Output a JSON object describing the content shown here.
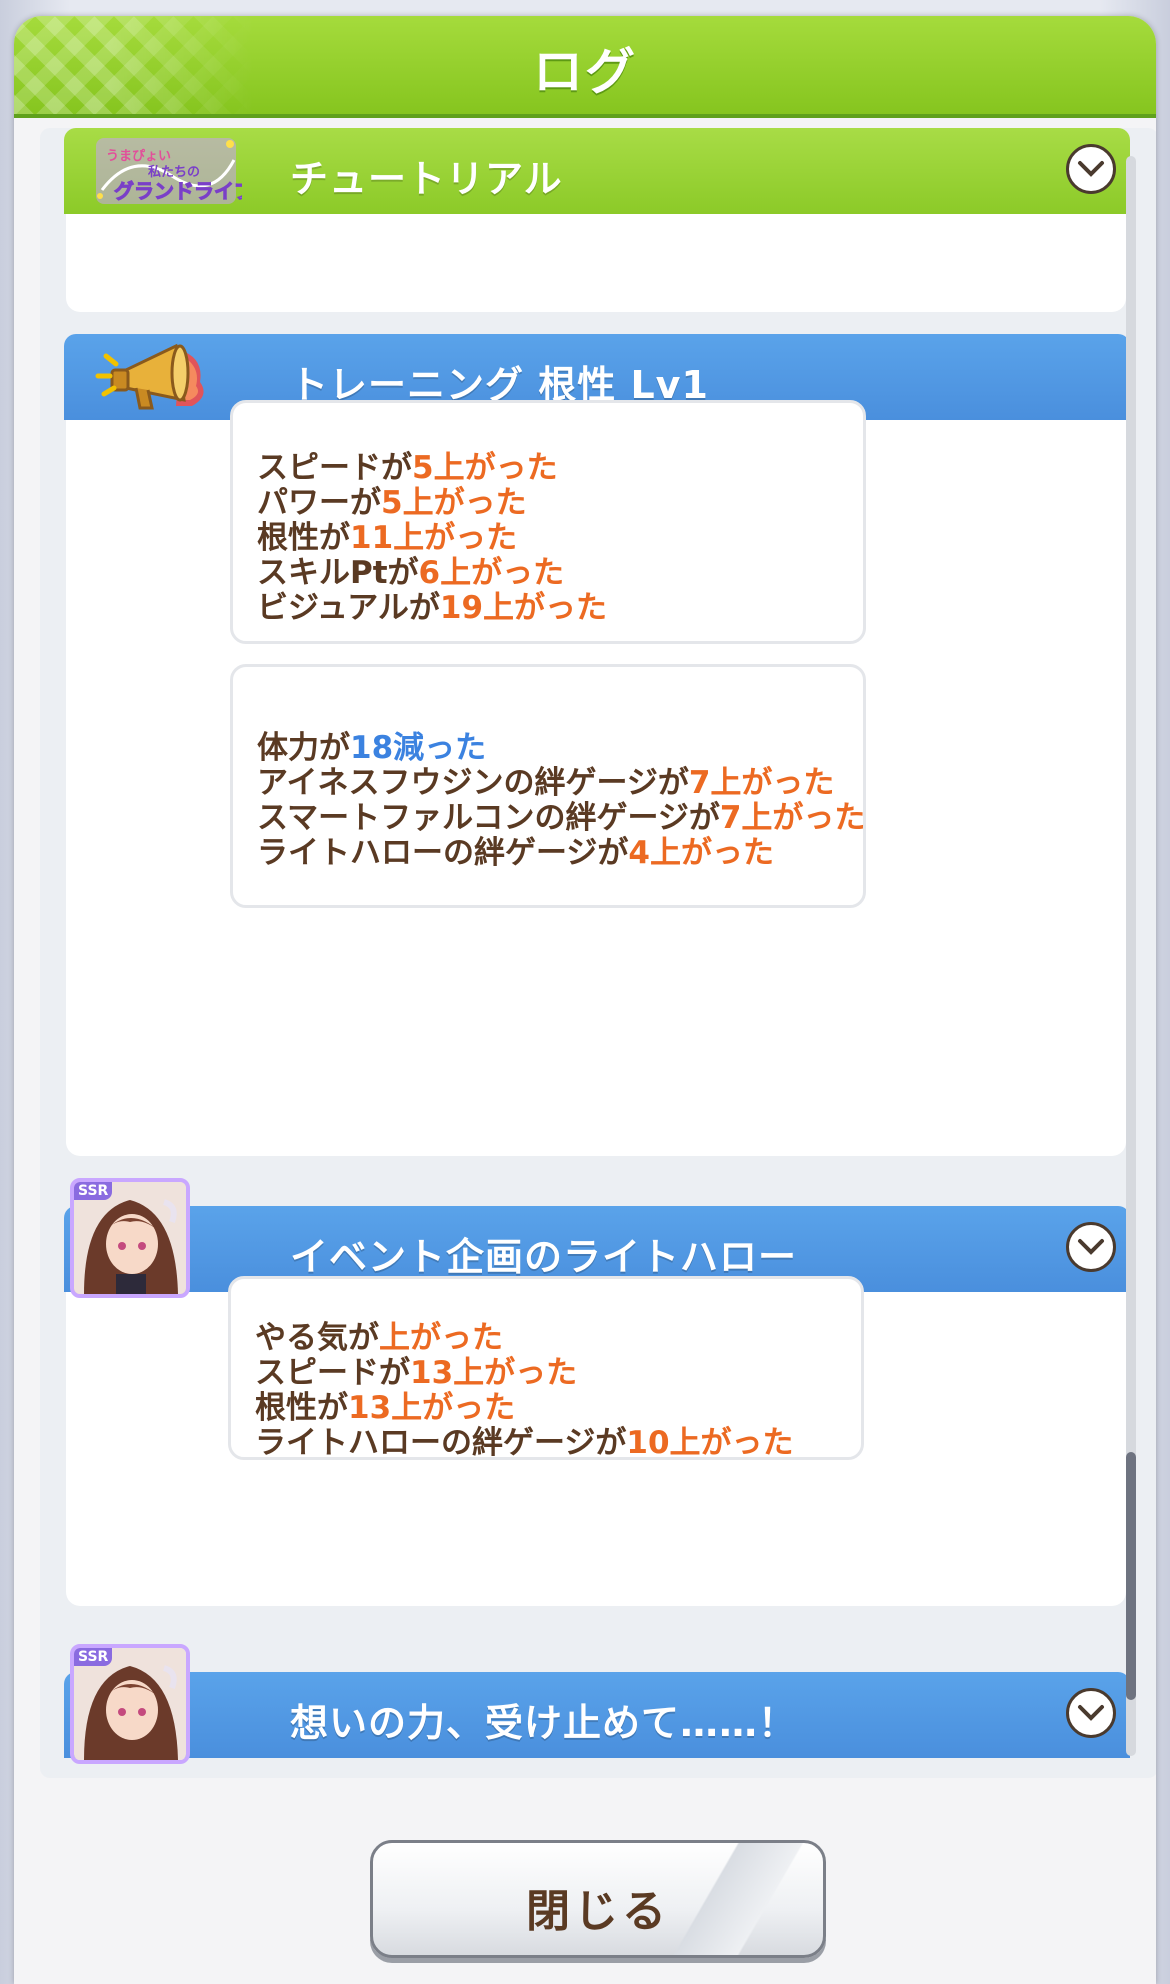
{
  "dialog": {
    "title": "ログ",
    "close_label": "閉じる"
  },
  "entries": [
    {
      "title": "チュートリアル",
      "icon": "grand-drive-logo",
      "logo_text": "うまぴょい・私たちのグランドライブ",
      "expanded": false
    },
    {
      "title": "トレーニング 根性 Lv1",
      "icon": "megaphone-icon",
      "expanded": true,
      "groups": [
        [
          {
            "pre": "スピードが",
            "val": "5上がった"
          },
          {
            "pre": "パワーが",
            "val": "5上がった"
          },
          {
            "pre": "根性が",
            "val": "11上がった"
          },
          {
            "pre": "スキルPtが",
            "val": "6上がった"
          },
          {
            "pre": "ビジュアルが",
            "val": "19上がった"
          }
        ],
        [
          {
            "pre": "体力が",
            "val": "18減った",
            "neg": true
          },
          {
            "pre": "アイネスフウジンの絆ゲージが",
            "val": "7上がった"
          },
          {
            "pre": "スマートファルコンの絆ゲージが",
            "val": "7上がった"
          },
          {
            "pre": "ライトハローの絆ゲージが",
            "val": "4上がった"
          }
        ]
      ]
    },
    {
      "title": "イベント企画のライトハロー",
      "icon": "ssr-character-portrait",
      "badge": "SSR",
      "expanded": false,
      "groups": [
        [
          {
            "pre": "やる気が",
            "val": "上がった"
          },
          {
            "pre": "スピードが",
            "val": "13上がった"
          },
          {
            "pre": "根性が",
            "val": "13上がった"
          },
          {
            "pre": "ライトハローの絆ゲージが",
            "val": "10上がった"
          }
        ]
      ]
    },
    {
      "title": "想いの力、受け止めて……！",
      "icon": "ssr-character-portrait",
      "badge": "SSR",
      "expanded": false
    }
  ],
  "colors": {
    "title_bar": "#8cca28",
    "header_blue": "#4a8fdd",
    "header_green": "#8cca28",
    "value_up": "#ec6a22",
    "value_down": "#3b82e0",
    "text_brown": "#5a3a23"
  }
}
